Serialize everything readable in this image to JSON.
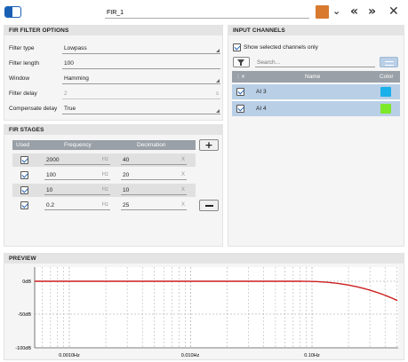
{
  "toolbar": {
    "filter_name": "FIR_1",
    "color": "#d8792e",
    "icons": [
      "toggle-icon",
      "chevron-down-icon",
      "double-left-icon",
      "double-right-icon",
      "close-icon"
    ]
  },
  "fir_options": {
    "title": "FIR FILTER OPTIONS",
    "rows": [
      {
        "label": "Filter type",
        "value": "Lowpass"
      },
      {
        "label": "Filter length",
        "value": "100"
      },
      {
        "label": "Window",
        "value": "Hamming"
      },
      {
        "label": "Filter delay",
        "value": "2",
        "unit": "s"
      },
      {
        "label": "Compensate delay",
        "value": "True"
      }
    ]
  },
  "fir_stages": {
    "title": "FIR STAGES",
    "headers": {
      "used": "Used",
      "frequency": "Frequency",
      "decimation": "Decimation"
    },
    "freq_unit": "Hz",
    "dec_unit": "X",
    "rows": [
      {
        "frequency": "2000",
        "decimation": "40"
      },
      {
        "frequency": "100",
        "decimation": "20"
      },
      {
        "frequency": "10",
        "decimation": "10"
      },
      {
        "frequency": "0.2",
        "decimation": "25"
      }
    ]
  },
  "input_channels": {
    "title": "INPUT CHANNELS",
    "show_selected_label": "Show selected channels only",
    "search_placeholder": "Search...",
    "headers": {
      "name": "Name",
      "color": "Color"
    },
    "rows": [
      {
        "name": "AI 3",
        "color": "#1ab0ea"
      },
      {
        "name": "AI 4",
        "color": "#7ee82a"
      }
    ]
  },
  "preview": {
    "title": "PREVIEW",
    "y_labels": [
      "0dB",
      "-50dB",
      "-100dB"
    ],
    "x_labels": [
      "0.0010Hz",
      "0.010Hz",
      "0.10Hz"
    ],
    "curve_color": "#cc1f1f"
  }
}
